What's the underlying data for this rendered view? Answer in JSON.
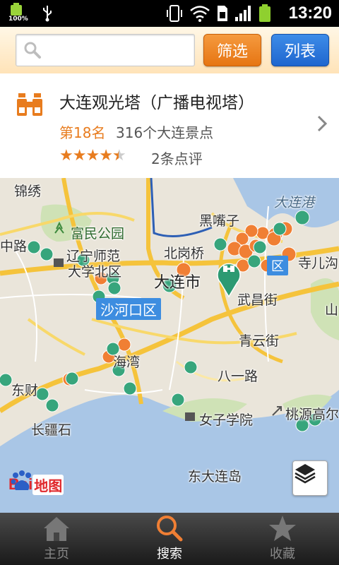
{
  "status_bar": {
    "battery_left": "100%",
    "time": "13:20"
  },
  "header": {
    "search_placeholder": "",
    "filter_label": "筛选",
    "list_label": "列表"
  },
  "poi": {
    "title": "大连观光塔（广播电视塔）",
    "rank": "第18名",
    "count_text": "316个大连景点",
    "rating": 4.5,
    "reviews": "2条点评"
  },
  "map": {
    "labels": {
      "jinxiu": "锦绣",
      "fumin_park": "富民公园",
      "zhonglu": "中路",
      "liaoning_normal": "辽宁师范",
      "daxue_beiqu": "大学北区",
      "heizuizi": "黑嘴子",
      "dalian_port": "大连港",
      "beigangqiao": "北岗桥",
      "dalian_city": "大连市",
      "sierkou": "寺儿沟",
      "wuchangjie": "武昌街",
      "shan": "山",
      "qingyunjie": "青云街",
      "heishiwan": "海湾",
      "bayilu": "八一路",
      "dongcai": "东财",
      "nvzi_xueyuan": "女子学院",
      "taoyuan": "桃源高尔",
      "changjiangshi": "长疆石",
      "dongdalian_island": "东大连岛"
    },
    "district_tag": "沙河口区",
    "district_tag_right": "区",
    "logo": {
      "bai": "Bai",
      "map": "地图"
    }
  },
  "nav": {
    "home": "主页",
    "search": "搜索",
    "favorites": "收藏"
  },
  "colors": {
    "accent_orange": "#e87c1e",
    "accent_blue": "#2a72d6"
  }
}
